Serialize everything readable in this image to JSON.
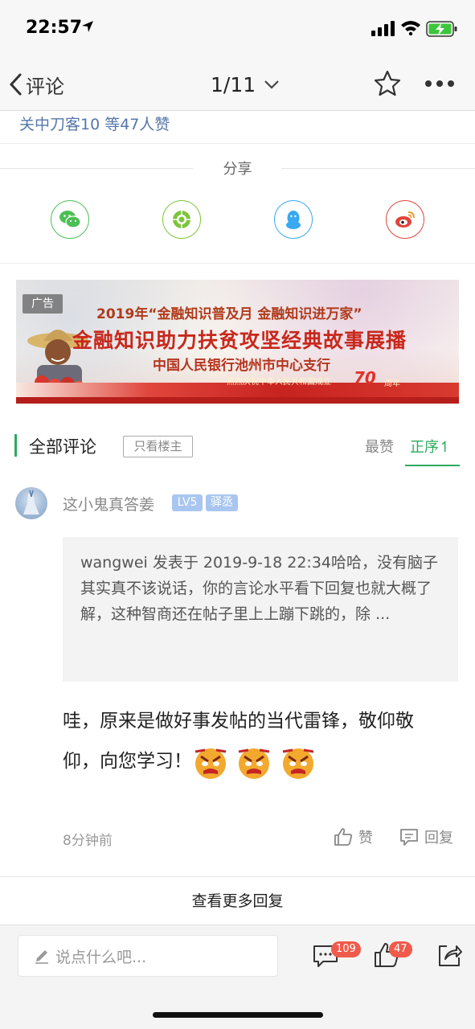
{
  "status_bar": {
    "time": "22:57"
  },
  "nav": {
    "back_label": "评论",
    "page_indicator": "1/11"
  },
  "likes_line": "关中刀客10 等47人赞",
  "share": {
    "title": "分享",
    "targets": [
      {
        "name": "wechat-icon",
        "color": "#4cbf56"
      },
      {
        "name": "moments-icon",
        "color": "#7cc43d"
      },
      {
        "name": "qq-icon",
        "color": "#38a9f0"
      },
      {
        "name": "weibo-icon",
        "color": "#e0453a"
      }
    ]
  },
  "ad": {
    "tag": "广告",
    "line1": "2019年“金融知识普及月 金融知识进万家”",
    "line2": "金融知识助力扶贫攻坚经典故事展播",
    "line3": "中国人民银行池州市中心支行",
    "anniversary": "热烈庆祝中华人民共和国成立",
    "years": "70",
    "years_unit": "周年"
  },
  "comments_header": {
    "title": "全部评论",
    "only_op": "只看楼主",
    "sort_top": "最赞",
    "sort_asc": "正序↿"
  },
  "comment": {
    "username": "这小鬼真答姜",
    "level": "LV5",
    "rank": "驿丞",
    "quote": "wangwei 发表于 2019-9-18 22:34哈哈，没有脑子其实真不该说话，你的言论水平看下回复也就大概了解，这种智商还在帖子里上上蹦下跳的，除 ...",
    "body": "哇，原来是做好事发帖的当代雷锋，敬仰敬仰，向您学习！",
    "time": "8分钟前",
    "like_label": "赞",
    "reply_label": "回复"
  },
  "more_replies": "查看更多回复",
  "bottom_bar": {
    "input_placeholder": "说点什么吧...",
    "comment_count": "109",
    "like_count": "47"
  }
}
